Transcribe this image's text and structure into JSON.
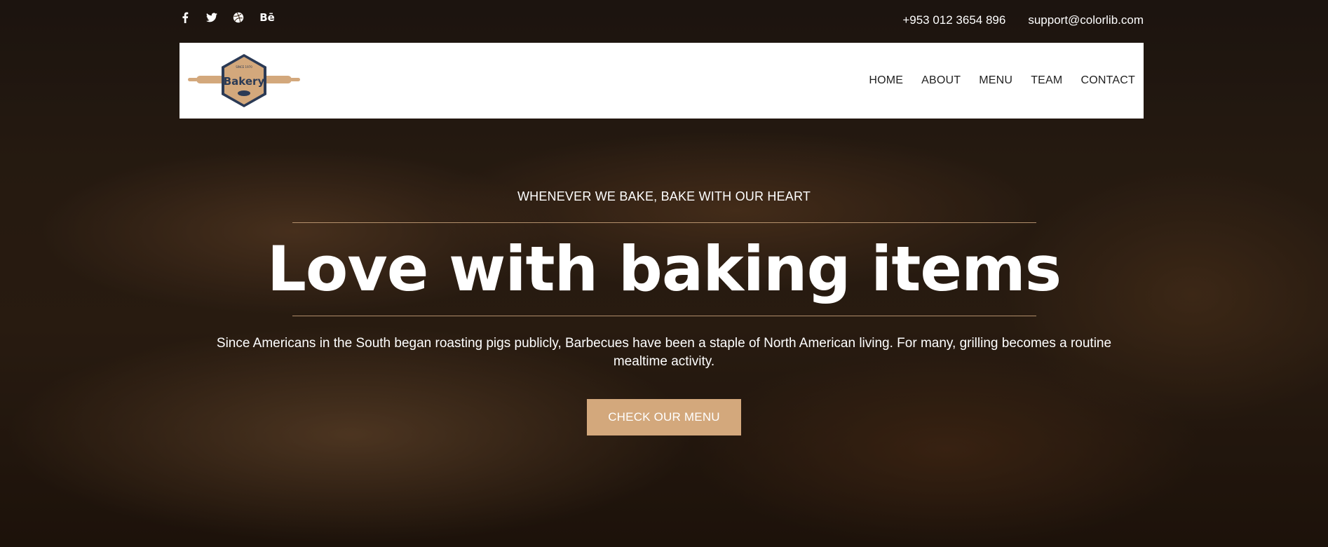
{
  "social": {
    "icons": [
      "facebook-icon",
      "twitter-icon",
      "dribbble-icon",
      "behance-icon"
    ]
  },
  "contact": {
    "phone": "+953 012 3654 896",
    "email": "support@colorlib.com"
  },
  "logo": {
    "text": "Bakery",
    "since": "SINCE 1970"
  },
  "nav": {
    "items": [
      "HOME",
      "ABOUT",
      "MENU",
      "TEAM",
      "CONTACT"
    ]
  },
  "hero": {
    "tagline": "WHENEVER WE BAKE, BAKE WITH OUR HEART",
    "headline": "Love with baking items",
    "description": "Since Americans in the South began roasting pigs publicly, Barbecues have been a staple of North American living. For many, grilling becomes a routine mealtime activity.",
    "cta_label": "CHECK OUR MENU"
  },
  "colors": {
    "accent": "#d3a87c",
    "logo_ring": "#2b3a55",
    "nav_text": "#1f1f1f"
  }
}
